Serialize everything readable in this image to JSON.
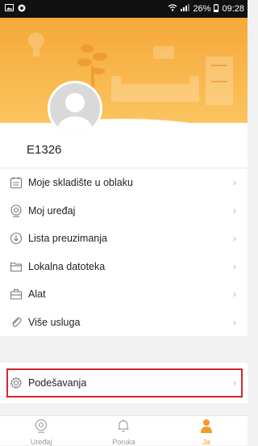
{
  "status_bar": {
    "battery_percent": "26%",
    "time": "09:28"
  },
  "user": {
    "id": "E1326"
  },
  "menu": [
    {
      "label": "Moje skladište u oblaku",
      "icon": "cloud-storage-icon"
    },
    {
      "label": "Moj uređaj",
      "icon": "device-icon"
    },
    {
      "label": "Lista preuzimanja",
      "icon": "download-icon"
    },
    {
      "label": "Lokalna datoteka",
      "icon": "folder-icon"
    },
    {
      "label": "Alat",
      "icon": "toolbox-icon"
    },
    {
      "label": "Više usluga",
      "icon": "paperclip-icon"
    }
  ],
  "settings": {
    "label": "Podešavanja",
    "icon": "gear-icon"
  },
  "tabs": [
    {
      "label": "Uređaj",
      "icon": "camera-icon",
      "active": false
    },
    {
      "label": "Poruka",
      "icon": "bell-icon",
      "active": false
    },
    {
      "label": "Ja",
      "icon": "person-icon",
      "active": true
    }
  ],
  "colors": {
    "accent": "#f29a2b",
    "header_top": "#f6a838",
    "highlight": "#d6262e"
  }
}
